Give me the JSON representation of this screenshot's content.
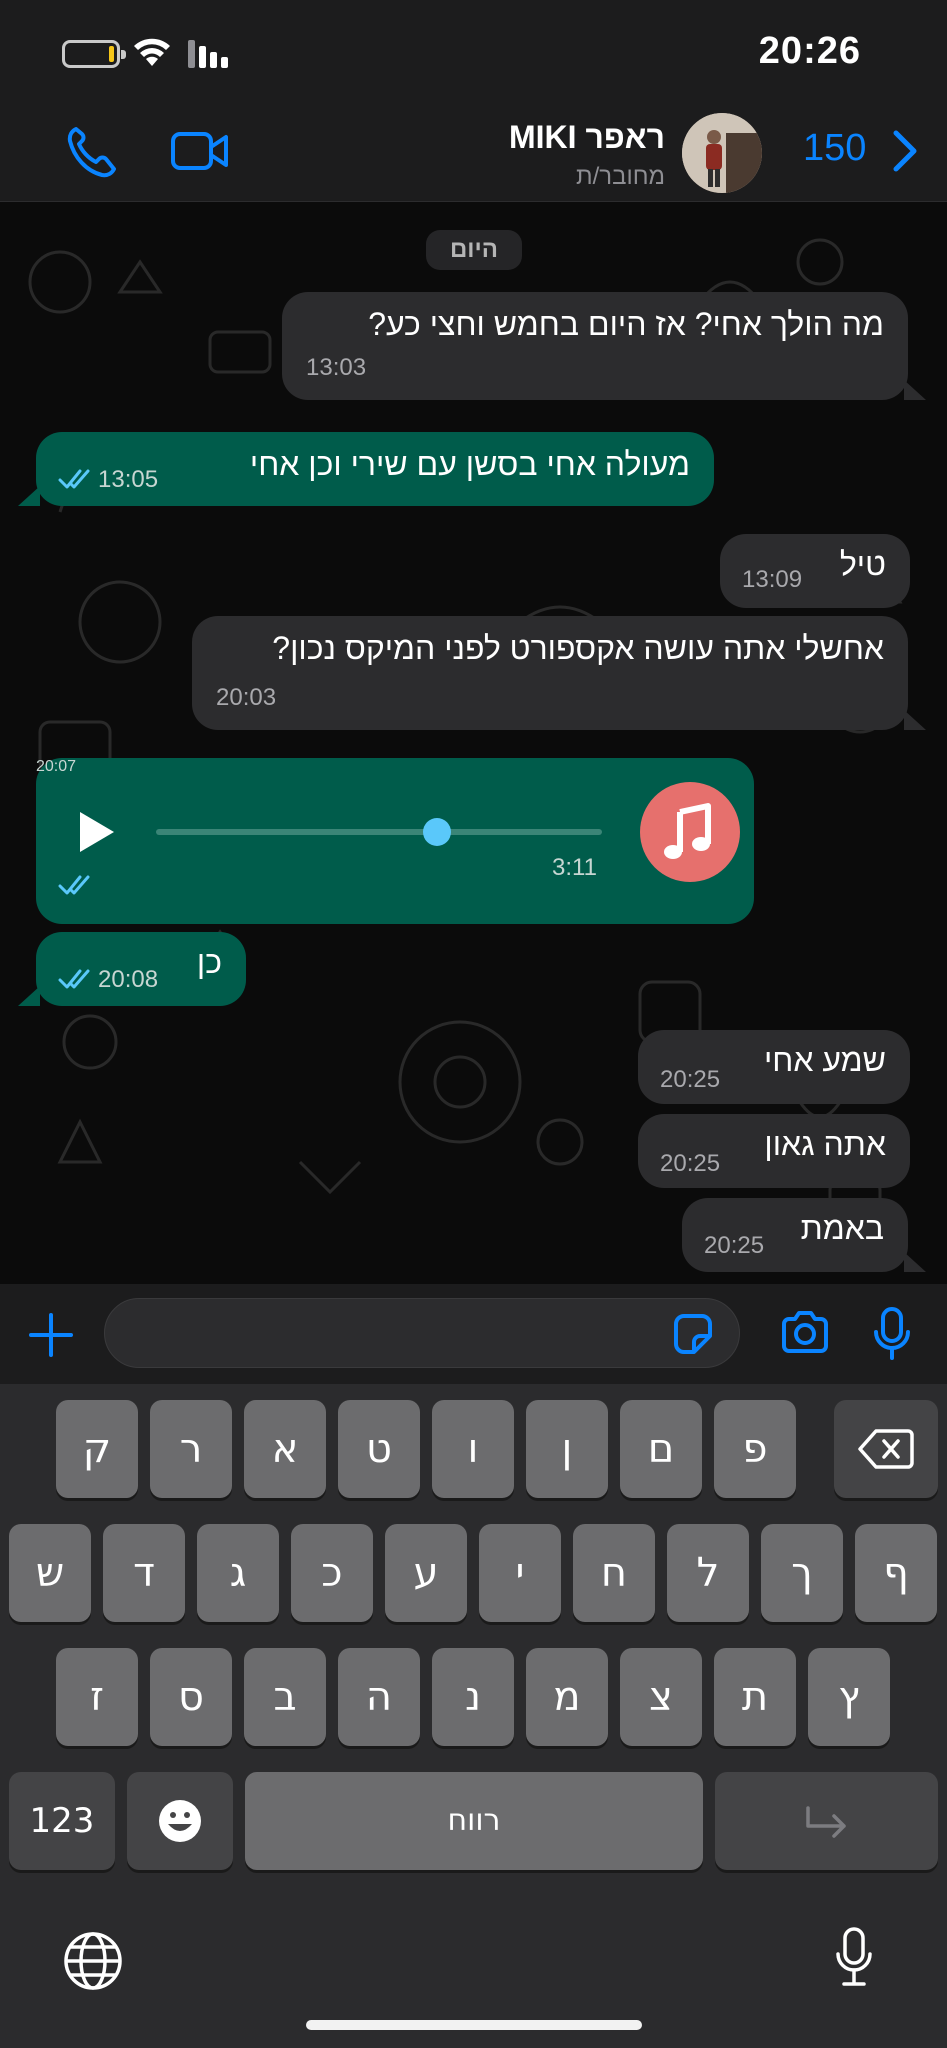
{
  "status_bar": {
    "time": "20:26"
  },
  "header": {
    "contact_name": "ראפר MIKI",
    "contact_status": "מחובר/ת",
    "unread_count": "150"
  },
  "chat": {
    "date_chip": "היום",
    "messages": [
      {
        "direction": "in",
        "text": "מה הולך אחי? אז היום בחמש וחצי כע?",
        "time": "13:03"
      },
      {
        "direction": "out",
        "text": "מעולה אחי בסשן עם שירי וכן אחי",
        "time": "13:05",
        "read": true
      },
      {
        "direction": "in",
        "text": "טיל",
        "time": "13:09"
      },
      {
        "direction": "in",
        "text": "אחשלי אתה עושה אקספורט לפני המיקס נכון?",
        "time": "20:03"
      },
      {
        "direction": "out",
        "text": "כן",
        "time": "20:08",
        "read": true
      },
      {
        "direction": "in",
        "text": "שמע אחי",
        "time": "20:25"
      },
      {
        "direction": "in",
        "text": "אתה גאון",
        "time": "20:25"
      },
      {
        "direction": "in",
        "text": "באמת",
        "time": "20:25"
      }
    ],
    "voice_message": {
      "duration": "3:11",
      "time": "20:07",
      "progress": 0.63,
      "read": true
    }
  },
  "input": {
    "placeholder": ""
  },
  "keyboard": {
    "row1": [
      "ק",
      "ר",
      "א",
      "ט",
      "ו",
      "ן",
      "ם",
      "פ"
    ],
    "row2": [
      "ש",
      "ד",
      "ג",
      "כ",
      "ע",
      "י",
      "ח",
      "ל",
      "ך",
      "ף"
    ],
    "row3": [
      "ז",
      "ס",
      "ב",
      "ה",
      "נ",
      "מ",
      "צ",
      "ת",
      "ץ"
    ],
    "numbers_key": "123",
    "space_key": "רווח"
  },
  "colors": {
    "accent": "#0a84ff",
    "incoming_bubble": "#2c2c2e",
    "outgoing_bubble": "#005c4b",
    "read_ticks": "#5ac8fa",
    "music_avatar": "#e6706d"
  },
  "icons": [
    "phone-icon",
    "video-camera-icon",
    "chevron-right-icon",
    "double-check-icon",
    "play-icon",
    "music-note-icon",
    "plus-icon",
    "sticker-icon",
    "camera-icon",
    "microphone-icon",
    "backspace-icon",
    "return-icon",
    "emoji-icon",
    "globe-icon",
    "dictation-icon"
  ]
}
